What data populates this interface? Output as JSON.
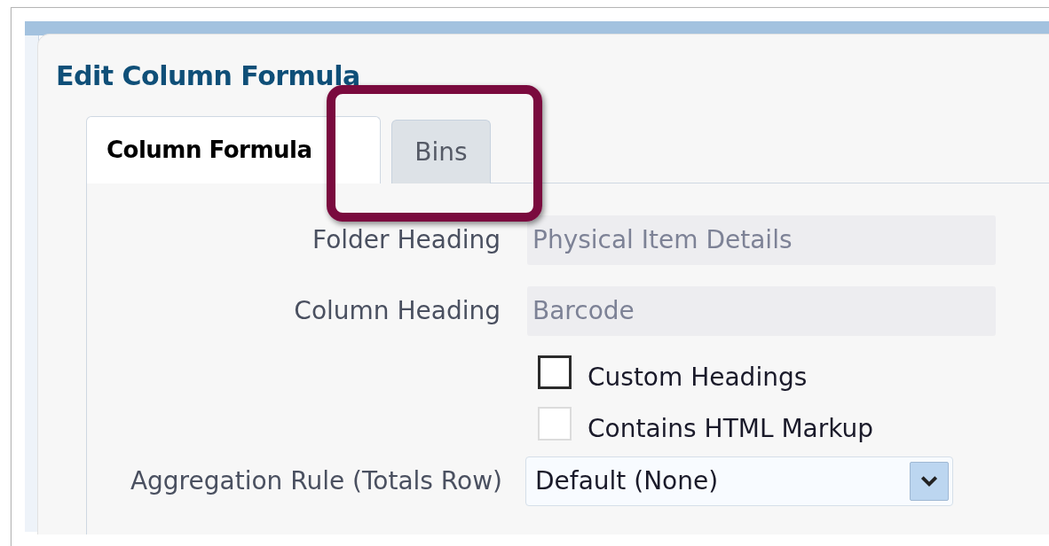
{
  "dialog": {
    "title": "Edit Column Formula"
  },
  "tabs": [
    {
      "label": "Column Formula",
      "selected": true
    },
    {
      "label": "Bins",
      "selected": false
    }
  ],
  "fields": [
    {
      "kind": "text",
      "label": "Folder Heading",
      "value": "Physical Item Details"
    },
    {
      "kind": "text",
      "label": "Column Heading",
      "value": "Barcode"
    },
    {
      "kind": "checkbox",
      "label": "Custom Headings",
      "checked": false,
      "disabled": false
    },
    {
      "kind": "checkbox",
      "label": "Contains HTML Markup",
      "checked": false,
      "disabled": true
    },
    {
      "kind": "select",
      "label": "Aggregation Rule (Totals Row)",
      "value": "Default (None)"
    }
  ],
  "annotation": {
    "kind": "highlight"
  }
}
